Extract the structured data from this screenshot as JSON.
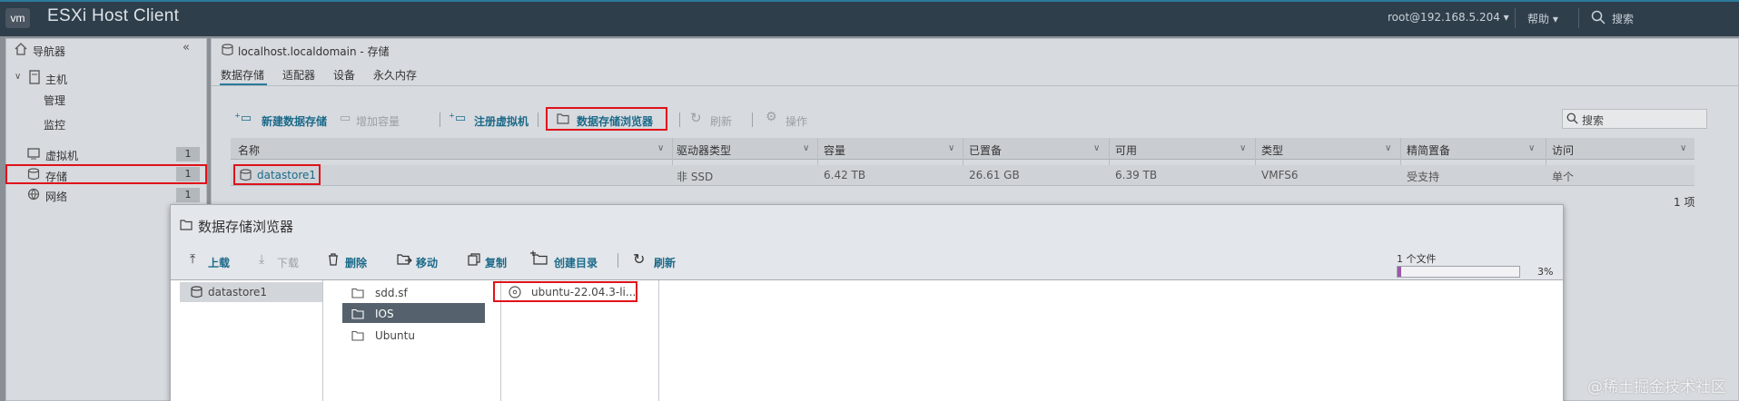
{
  "header": {
    "logo": "vm",
    "app_title": "ESXi Host Client",
    "user": "root@192.168.5.204 ▾",
    "help": "帮助 ▾",
    "search": "搜索"
  },
  "navigator": {
    "title": "导航器",
    "host": {
      "label": "主机",
      "children": [
        "管理",
        "监控"
      ]
    },
    "items": [
      {
        "label": "虚拟机",
        "count": "1"
      },
      {
        "label": "存储",
        "count": "1"
      },
      {
        "label": "网络",
        "count": "1"
      }
    ]
  },
  "main": {
    "breadcrumb": "localhost.localdomain - 存储",
    "tabs": [
      "数据存储",
      "适配器",
      "设备",
      "永久内存"
    ],
    "toolbar": {
      "new_datastore": "新建数据存储",
      "increase_capacity": "增加容量",
      "register_vm": "注册虚拟机",
      "datastore_browser": "数据存储浏览器",
      "refresh": "刷新",
      "actions": "操作"
    },
    "search_placeholder": "搜索",
    "columns": [
      "名称",
      "驱动器类型",
      "容量",
      "已置备",
      "可用",
      "类型",
      "精简置备",
      "访问"
    ],
    "rows": [
      [
        "datastore1",
        "非 SSD",
        "6.42 TB",
        "26.61 GB",
        "6.39 TB",
        "VMFS6",
        "受支持",
        "单个"
      ]
    ],
    "count": "1 项"
  },
  "dialog": {
    "title": "数据存储浏览器",
    "buttons": {
      "upload": "上载",
      "download": "下载",
      "delete": "删除",
      "move": "移动",
      "copy": "复制",
      "mkdir": "创建目录",
      "refresh": "刷新"
    },
    "progress": {
      "label": "1 个文件",
      "percent_text": "3%",
      "value": 0.03
    },
    "datastores": [
      "datastore1"
    ],
    "folders": [
      "sdd.sf",
      "IOS",
      "Ubuntu"
    ],
    "files": [
      "ubuntu-22.04.3-li..."
    ]
  },
  "watermark": "@稀土掘金技术社区",
  "colors": {
    "accent": "#1b6a8a",
    "highlight": "#e0121a",
    "topbar": "#2f3e4b",
    "selected": "#55626d"
  }
}
